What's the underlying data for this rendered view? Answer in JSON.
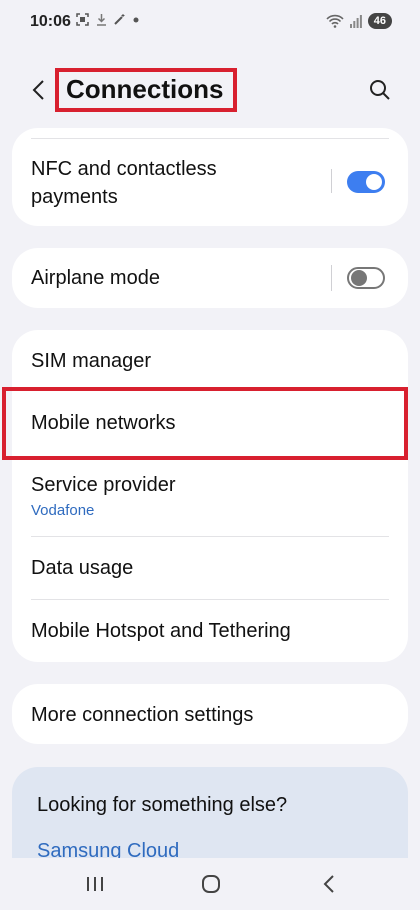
{
  "status_bar": {
    "time": "10:06",
    "notification_icons": [
      "screenshot-icon",
      "download-icon",
      "magic-wand-icon",
      "dot-icon"
    ],
    "battery": "46"
  },
  "header": {
    "title": "Connections"
  },
  "nfc": {
    "label_line1": "NFC and contactless",
    "label_line2": "payments",
    "toggle_on": true
  },
  "airplane": {
    "label": "Airplane mode",
    "toggle_on": false
  },
  "group": {
    "sim_manager": "SIM manager",
    "mobile_networks": "Mobile networks",
    "service_provider": "Service provider",
    "service_provider_value": "Vodafone",
    "data_usage": "Data usage",
    "hotspot": "Mobile Hotspot and Tethering"
  },
  "more": {
    "label": "More connection settings"
  },
  "looking": {
    "question": "Looking for something else?",
    "link": "Samsung Cloud"
  },
  "colors": {
    "accent": "#3d7ef0",
    "link": "#2f6bbf",
    "highlight": "#d8202f",
    "background": "#f2f2f7"
  }
}
